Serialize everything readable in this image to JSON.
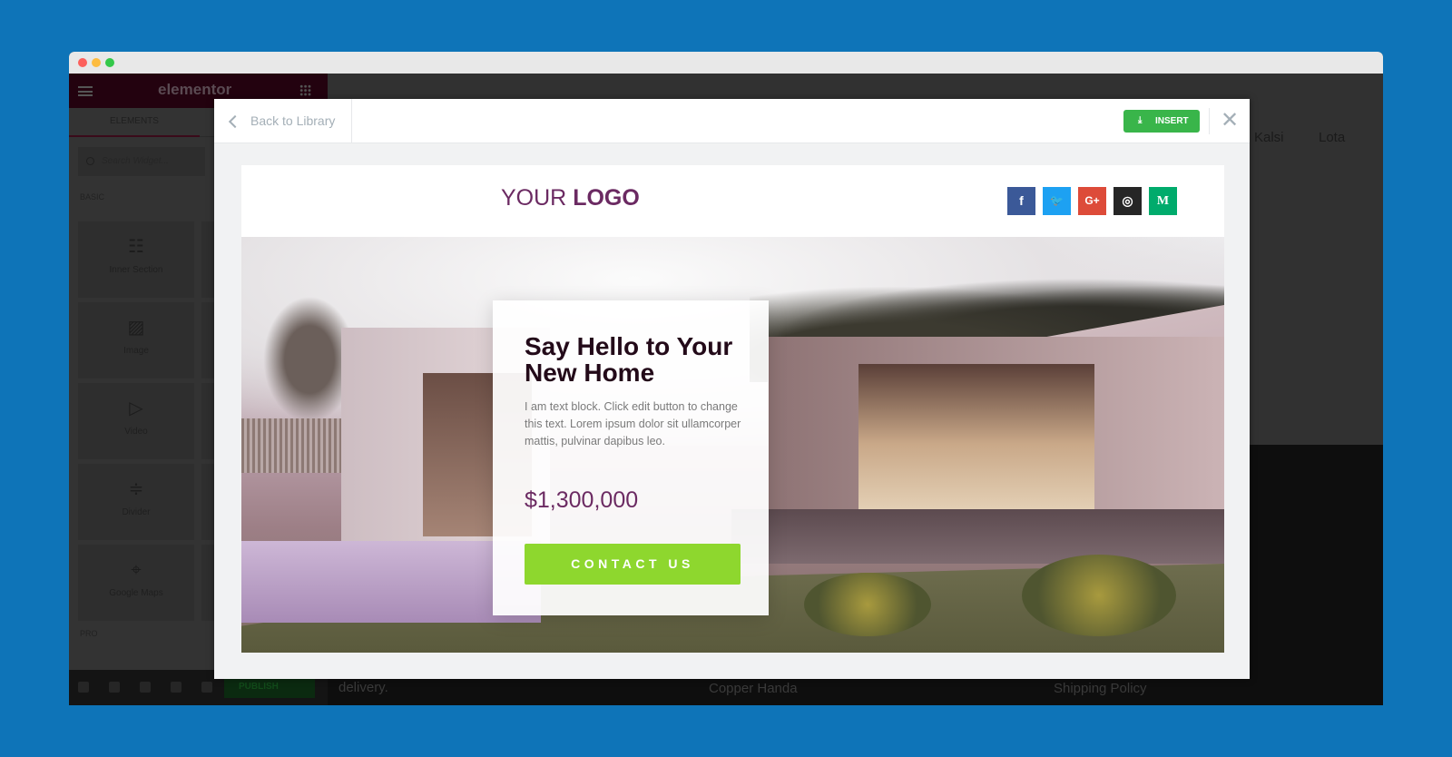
{
  "editor": {
    "brand": "elementor",
    "tab": "ELEMENTS",
    "search_placeholder": "Search Widget...",
    "categories": [
      "BASIC",
      "PRO"
    ],
    "widgets": [
      {
        "label": "Inner Section",
        "icon": "columns-icon"
      },
      {
        "label": "Image",
        "icon": "image-icon"
      },
      {
        "label": "Video",
        "icon": "video-icon"
      },
      {
        "label": "Divider",
        "icon": "divider-icon"
      },
      {
        "label": "Google Maps",
        "icon": "map-icon"
      }
    ],
    "publish_label": "PUBLISH"
  },
  "background_page": {
    "nav": [
      "Kalsi",
      "Lota"
    ],
    "footer_text": "delivery.",
    "links": [
      "Copper Handa",
      "Shipping Policy"
    ]
  },
  "modal": {
    "back_label": "Back to Library",
    "insert_label": "INSERT",
    "close_symbol": "✕"
  },
  "template": {
    "logo_light": "YOUR ",
    "logo_bold": "LOGO",
    "social": [
      {
        "name": "facebook",
        "glyph": "f",
        "color": "#3b5998"
      },
      {
        "name": "twitter",
        "glyph": "🐦",
        "color": "#1da1f2"
      },
      {
        "name": "google-plus",
        "glyph": "G+",
        "color": "#dd4b39"
      },
      {
        "name": "instagram",
        "glyph": "◎",
        "color": "#262626"
      },
      {
        "name": "medium",
        "glyph": "M",
        "color": "#00ab6c"
      }
    ],
    "title": "Say Hello to Your New Home",
    "body": "I am text block. Click edit button to change this text. Lorem ipsum dolor sit ullamcorper mattis, pulvinar dapibus leo.",
    "price": "$1,300,000",
    "cta": "CONTACT US",
    "accent": "#6b2a62",
    "cta_color": "#8ed72e"
  }
}
